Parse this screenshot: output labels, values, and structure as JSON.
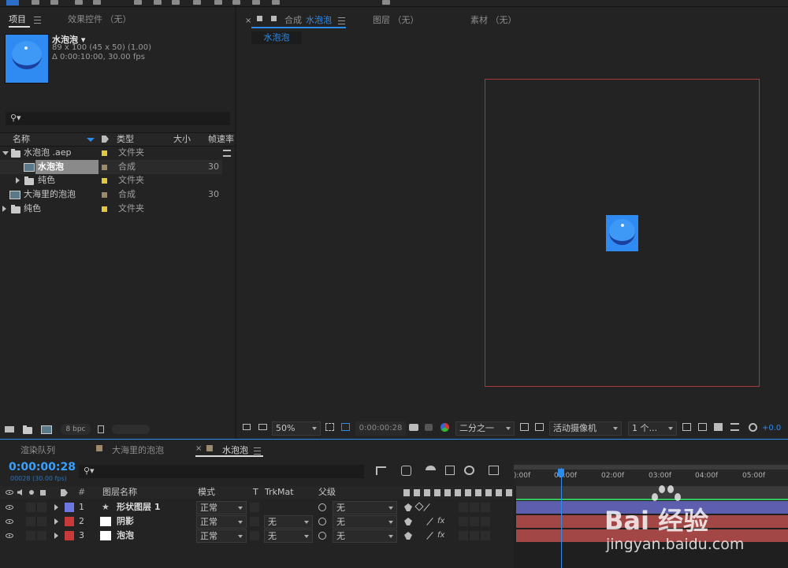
{
  "project_panel": {
    "tab_project": "项目",
    "tab_effects": "效果控件 （无）",
    "selected_name": "水泡泡 ▾",
    "selected_info_1": "89 x 100  (45 x 50) (1.00)",
    "selected_info_2": "Δ 0:00:10:00, 30.00 fps",
    "search_icon": "⚲▾",
    "columns": {
      "name": "名称",
      "type": "类型",
      "size": "大小",
      "fps": "帧速率"
    },
    "items": [
      {
        "name": "水泡泡 .aep",
        "type": "文件夹",
        "fps": "",
        "color": "#e2c83f"
      },
      {
        "name": "水泡泡",
        "type": "合成",
        "fps": "30",
        "color": "#9c8a6c"
      },
      {
        "name": "纯色",
        "type": "文件夹",
        "fps": "",
        "color": "#e2c83f"
      },
      {
        "name": "大海里的泡泡",
        "type": "合成",
        "fps": "30",
        "color": "#9c8a6c"
      },
      {
        "name": "纯色",
        "type": "文件夹",
        "fps": "",
        "color": "#e2c83f"
      }
    ],
    "bpc": "8 bpc"
  },
  "comp_panel": {
    "tab_comp_prefix": "合成",
    "tab_comp_name": "水泡泡",
    "tab_layer": "图层 （无）",
    "tab_footage": "素材 （无）",
    "breadcrumb": "水泡泡",
    "zoom": "50%",
    "timecode": "0:00:00:28",
    "resolution": "二分之一",
    "camera": "活动摄像机",
    "views": "1 个...",
    "exposure": "+0.0"
  },
  "timeline_panel": {
    "tab_render": "渲染队列",
    "tab_ocean": "大海里的泡泡",
    "tab_bubble": "水泡泡",
    "timecode": "0:00:00:28",
    "frame_info": "00028 (30.00 fps)",
    "col_num": "#",
    "col_layer_name": "图层名称",
    "col_mode": "模式",
    "col_t": "T",
    "col_trkmat": "TrkMat",
    "col_parent": "父级",
    "ruler": [
      "):00f",
      "01:00f",
      "02:00f",
      "03:00f",
      "04:00f",
      "05:00f"
    ],
    "layers": [
      {
        "num": "1",
        "name": "形状图层 1",
        "mode": "正常",
        "trkmat": "",
        "parent": "无",
        "label_color": "#6f78e0",
        "lane_color": "#5d5fae"
      },
      {
        "num": "2",
        "name": "阴影",
        "mode": "正常",
        "trkmat": "无",
        "parent": "无",
        "label_color": "#c83a3a",
        "lane_color": "#a34646"
      },
      {
        "num": "3",
        "name": "泡泡",
        "mode": "正常",
        "trkmat": "无",
        "parent": "无",
        "label_color": "#c83a3a",
        "lane_color": "#a34646"
      }
    ]
  },
  "watermark": {
    "brand": "Bai 经验",
    "url": "jingyan.baidu.com"
  },
  "colors": {
    "accent": "#2d8ceb",
    "timecode": "#3aa0ff",
    "comp_border": "#a63a3a",
    "bubble": "#2f8af2"
  }
}
